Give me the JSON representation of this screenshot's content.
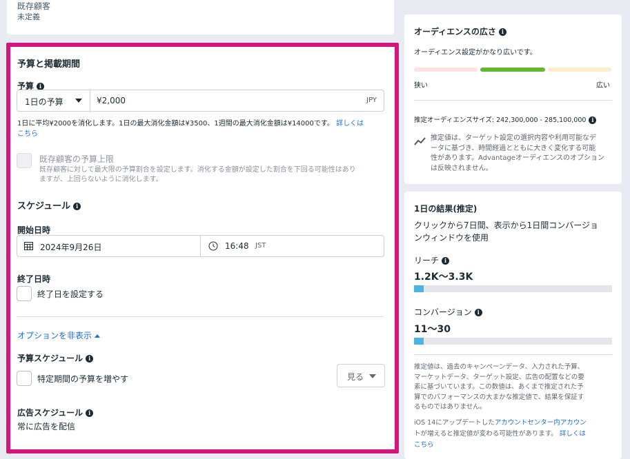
{
  "existing_customers": {
    "title": "既存顧客",
    "value": "未定義"
  },
  "budget_section": {
    "title": "予算と掲載期間",
    "budget_label": "予算",
    "budget_type": "1日の予算",
    "budget_amount": "¥2,000",
    "currency": "JPY",
    "budget_note": "1日に平均¥2000を消化します。1日の最大消化金額は¥3500、1週間の最大消化金額は¥14000です。",
    "learn_more_1": "詳しくは",
    "learn_more_2": "こちら",
    "cap_title": "既存顧客の予算上限",
    "cap_desc_1": "既存顧客に対して最大限の予算割合を設定します。消化する金額が設定した割合を下回る可能性はあり",
    "cap_desc_2": "ますが、上回らないように消化します。",
    "schedule_title": "スケジュール",
    "start_label": "開始日時",
    "start_date": "2024年9月26日",
    "start_time": "16:48",
    "timezone": "JST",
    "end_label": "終了日時",
    "end_checkbox_label": "終了日を設定する",
    "options_toggle": "オプションを非表示",
    "budget_schedule_title": "予算スケジュール",
    "budget_schedule_checkbox": "特定期間の予算を増やす",
    "view_button": "見る",
    "ad_schedule_title": "広告スケジュール",
    "ad_schedule_value": "常に広告を配信"
  },
  "audience": {
    "title": "オーディエンスの広さ",
    "status": "オーディエンス設定がかなり広いです。",
    "narrow": "狭い",
    "broad": "広い",
    "colors": {
      "narrow": "#fce3e1",
      "mid": "#63b830",
      "broad": "#fdefc7"
    },
    "size_text": "推定オーディエンスサイズ: 242,300,000 - 285,100,000",
    "note_1": "推定値は、ターゲット設定の選択内容や利用可能なデ",
    "note_2": "ータに基づき、時間経過とともに大きく変化する可能",
    "note_3": "性があります。Advantageオーディエンスのオプション",
    "note_4": "は反映されません。"
  },
  "results": {
    "title": "1日の結果(推定)",
    "desc_1": "クリックから7日間、表示から1日間コンバージョ",
    "desc_2": "ンウィンドウを使用",
    "reach_label": "リーチ",
    "reach_value": "1.2K〜3.3K",
    "reach_fill": 0.05,
    "conv_label": "コンバージョン",
    "conv_value": "11〜30",
    "conv_fill": 0.05,
    "disclaimer_1": "推定値は、過去のキャンペーンデータ、入力された予算、",
    "disclaimer_2": "マーケットデータ、ターゲット設定、広告の配置などの要",
    "disclaimer_3": "素に基づいています。この数値は、あくまで推定された予",
    "disclaimer_4": "算でのパフォーマンスの大まかな推定値で、結果を保証す",
    "disclaimer_5": "るものではありません。",
    "ios_1": "iOS 14にアップデートした",
    "ios_link_1": "アカウントセンター内アカウン",
    "ios_link_2": "ト",
    "ios_2": "が増えると推定値が変わる可能性があります。",
    "learn_1": "詳しくは",
    "learn_2": "こちら"
  }
}
